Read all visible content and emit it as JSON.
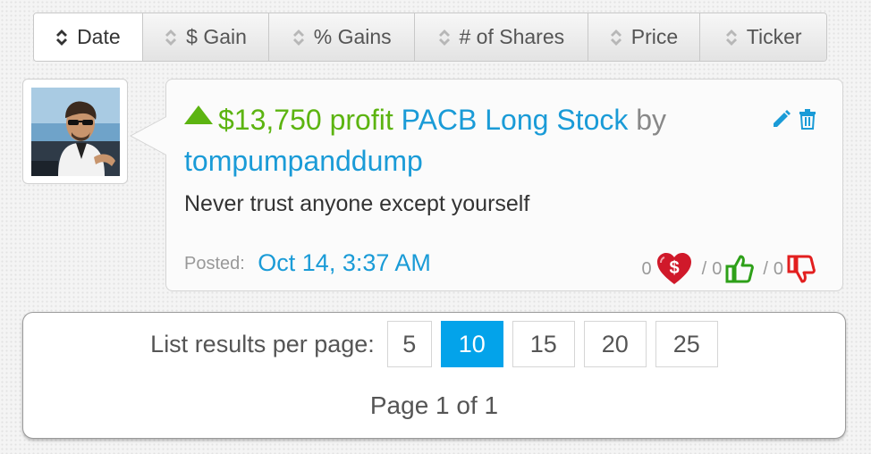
{
  "sort_tabs": [
    {
      "label": "Date",
      "active": true
    },
    {
      "label": "$ Gain",
      "active": false
    },
    {
      "label": "% Gains",
      "active": false
    },
    {
      "label": "# of Shares",
      "active": false
    },
    {
      "label": "Price",
      "active": false
    },
    {
      "label": "Ticker",
      "active": false
    }
  ],
  "post": {
    "profit": "$13,750 profit",
    "title": "PACB Long Stock",
    "by": "by",
    "author": "tompumpanddump",
    "comment": "Never trust anyone except yourself",
    "posted_label": "Posted:",
    "posted_date": "Oct 14, 3:37 AM",
    "tip_count": "0",
    "like_count": "0",
    "dislike_count": "0",
    "separator": "/",
    "colors": {
      "profit": "#5cb411",
      "link": "#1a9bd7"
    },
    "icons": [
      "edit-icon",
      "trash-icon",
      "dollar-heart-icon",
      "thumbs-up-icon",
      "thumbs-down-icon"
    ]
  },
  "pagination": {
    "per_page_label": "List results per page:",
    "options": [
      "5",
      "10",
      "15",
      "20",
      "25"
    ],
    "selected": "10",
    "status": "Page 1 of 1",
    "accent": "#03a3ea"
  }
}
